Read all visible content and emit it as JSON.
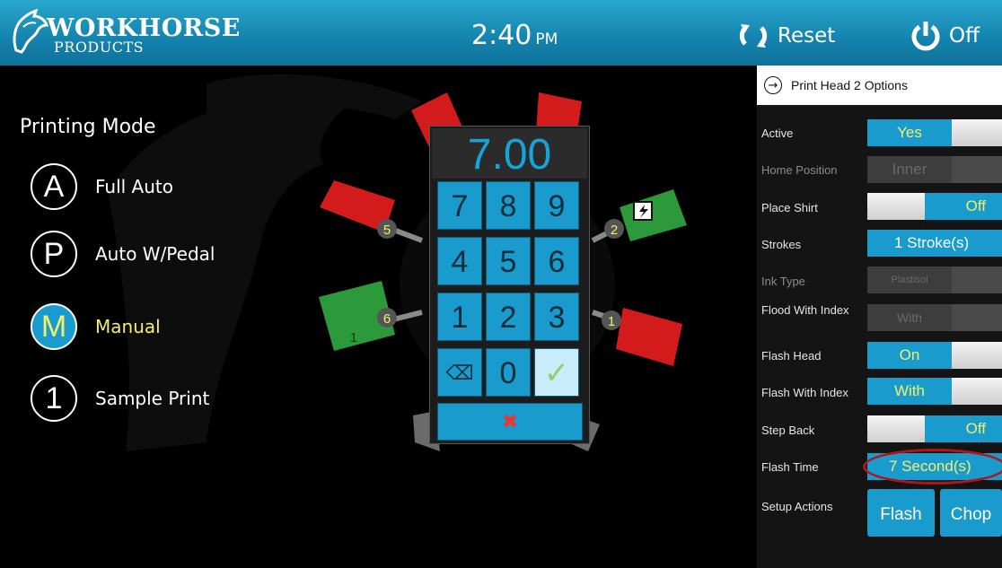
{
  "header": {
    "logo_text": "WORKHORSE",
    "logo_subtext": "PRODUCTS",
    "clock_time": "2:40",
    "clock_ampm": "PM",
    "reset_label": "Reset",
    "off_label": "Off"
  },
  "printing_mode": {
    "title": "Printing Mode",
    "modes": [
      {
        "letter": "A",
        "label": "Full Auto"
      },
      {
        "letter": "P",
        "label": "Auto W/Pedal"
      },
      {
        "letter": "M",
        "label": "Manual"
      },
      {
        "letter": "1",
        "label": "Sample Print"
      }
    ],
    "selected": "Manual"
  },
  "carousel": {
    "head_numbers": [
      "5",
      "2",
      "6",
      "1"
    ],
    "pallet_numbers": [
      "1"
    ]
  },
  "keypad": {
    "display_value": "7.00",
    "keys": [
      "7",
      "8",
      "9",
      "4",
      "5",
      "6",
      "1",
      "2",
      "3"
    ],
    "zero": "0",
    "backspace_glyph": "⌫",
    "ok_glyph": "✓",
    "cancel_glyph": "✖"
  },
  "right_panel": {
    "title": "Print Head 2 Options",
    "rows": {
      "active": {
        "label": "Active",
        "value": "Yes"
      },
      "home_position": {
        "label": "Home Position",
        "value": "Inner"
      },
      "place_shirt": {
        "label": "Place Shirt",
        "value": "Off"
      },
      "strokes": {
        "label": "Strokes",
        "value": "1 Stroke(s)"
      },
      "ink_type": {
        "label": "Ink Type",
        "value": "Plastisol"
      },
      "flood_with_index": {
        "label": "Flood With Index",
        "value": "With"
      },
      "flash_head": {
        "label": "Flash Head",
        "value": "On"
      },
      "flash_with_index": {
        "label": "Flash With Index",
        "value": "With"
      },
      "step_back": {
        "label": "Step Back",
        "value": "Off"
      },
      "flash_time": {
        "label": "Flash Time",
        "value": "7 Second(s)"
      },
      "setup_actions": {
        "label": "Setup Actions",
        "flash_label": "Flash",
        "chop_label": "Chop"
      }
    }
  },
  "colors": {
    "accent_blue": "#1a9bcd",
    "highlight_yellow": "#f3ef6a",
    "pallet_red": "#d41b1b",
    "pallet_green": "#2c9a3a",
    "oval_red": "#b2141b"
  }
}
